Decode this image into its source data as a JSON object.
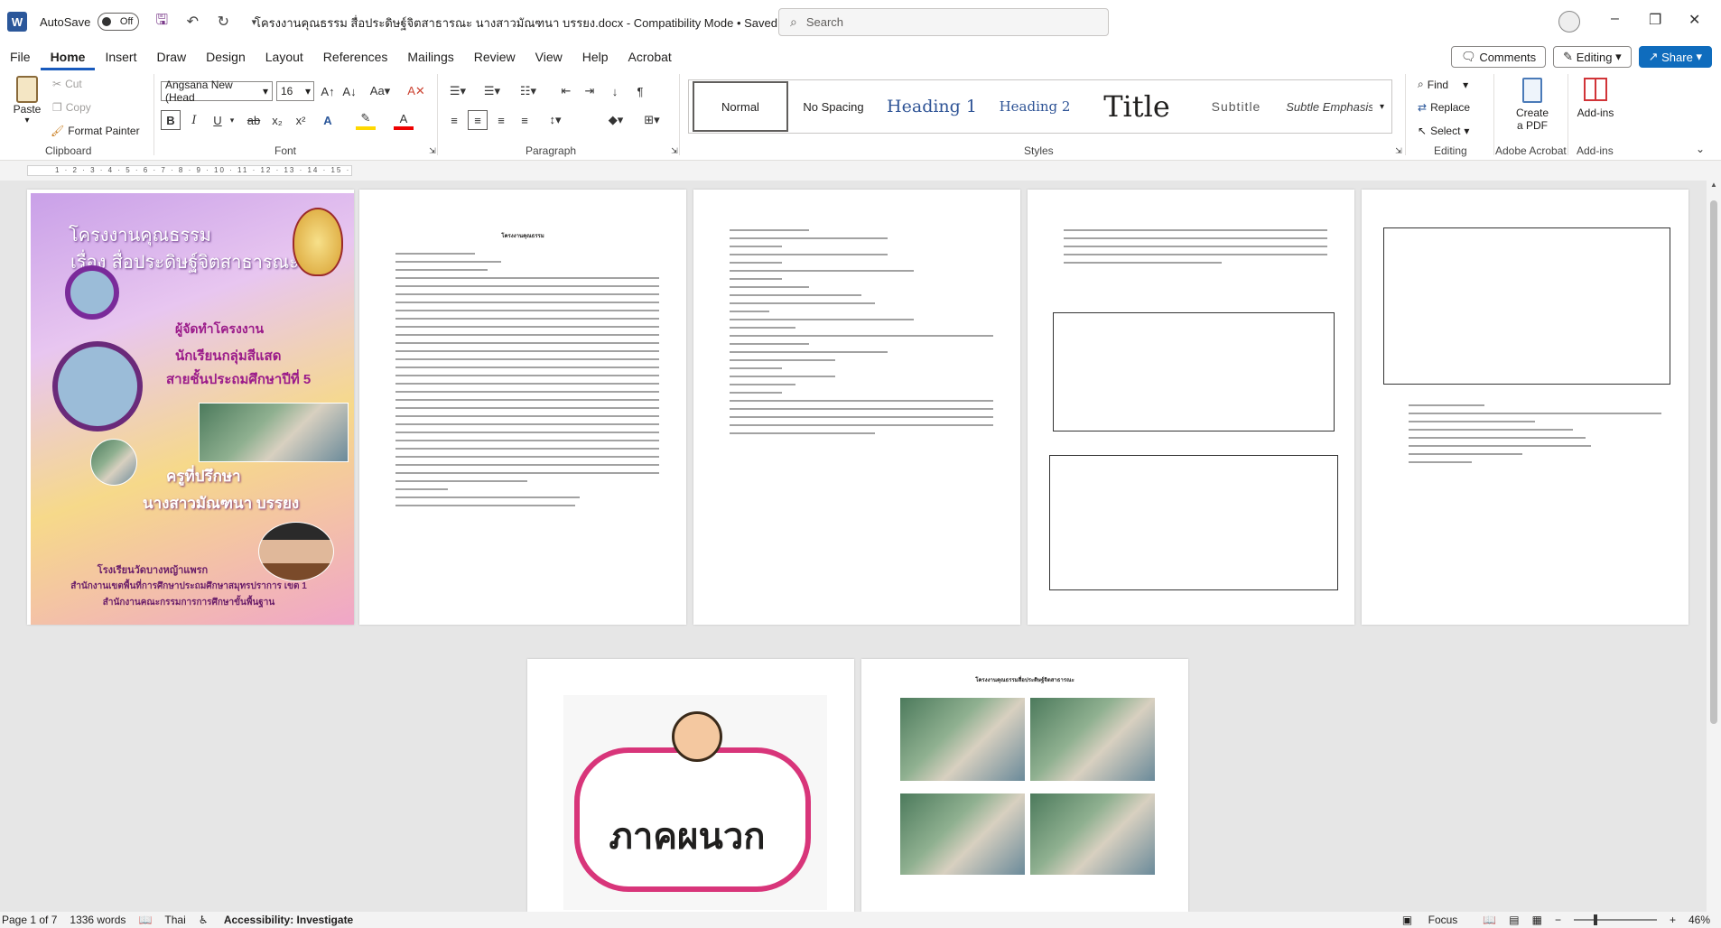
{
  "titlebar": {
    "app_icon": "W",
    "autosave_label": "AutoSave",
    "autosave_state": "Off",
    "document_title": "โครงงานคุณธรรม สื่อประดิษฐ์จิตสาธารณะ นางสาวมัณฑนา บรรยง.docx - Compatibility Mode • Saved",
    "search_placeholder": "Search"
  },
  "menu": {
    "tabs": [
      "File",
      "Home",
      "Insert",
      "Draw",
      "Design",
      "Layout",
      "References",
      "Mailings",
      "Review",
      "View",
      "Help",
      "Acrobat"
    ],
    "comments": "Comments",
    "editing": "Editing",
    "share": "Share"
  },
  "ribbon": {
    "clipboard": {
      "paste": "Paste",
      "cut": "Cut",
      "copy": "Copy",
      "format_painter": "Format Painter",
      "label": "Clipboard"
    },
    "font": {
      "family": "Angsana New (Head",
      "size": "16",
      "label": "Font"
    },
    "paragraph_label": "Paragraph",
    "styles": {
      "items": [
        "Normal",
        "No Spacing",
        "Heading 1",
        "Heading 2",
        "Title",
        "Subtitle",
        "Subtle Emphasis"
      ],
      "label": "Styles"
    },
    "editing": {
      "find": "Find",
      "replace": "Replace",
      "select": "Select",
      "label": "Editing"
    },
    "acrobat": {
      "create_pdf_line1": "Create",
      "create_pdf_line2": "a PDF",
      "label": "Adobe Acrobat"
    },
    "addins": {
      "button": "Add-ins",
      "label": "Add-ins"
    }
  },
  "ruler": {
    "ticks": "1 · 2 · 3 · 4 · 5 · 6 · 7 · 8 · 9 · 10 · 11 · 12 · 13 · 14 · 15 · 16"
  },
  "cover": {
    "title_line1": "โครงงานคุณธรรม",
    "title_line2": "เรื่อง สื่อประดิษฐ์จิตสาธารณะ",
    "maker_heading": "ผู้จัดทำโครงงาน",
    "maker_line1": "นักเรียนกลุ่มสีแสด",
    "maker_line2": "สายชั้นประถมศึกษาปีที่ 5",
    "advisor_heading": "ครูที่ปรึกษา",
    "advisor_name": "นางสาวมัณฑนา บรรยง",
    "school": "โรงเรียนวัดบางหญ้าแพรก",
    "office1": "สำนักงานเขตพื้นที่การศึกษาประถมศึกษาสมุทรปราการ เขต 1",
    "office2": "สำนักงานคณะกรรมการการศึกษาขั้นพื้นฐาน"
  },
  "page2": {
    "heading": "โครงงานคุณธรรม"
  },
  "appendix": {
    "text": "ภาคผนวก"
  },
  "photos_page": {
    "heading": "โครงงานคุณธรรมสื่อประดิษฐ์จิตสาธารณะ"
  },
  "status": {
    "page": "Page 1 of 7",
    "words": "1336 words",
    "language": "Thai",
    "accessibility": "Accessibility: Investigate",
    "focus": "Focus",
    "zoom": "46%"
  }
}
